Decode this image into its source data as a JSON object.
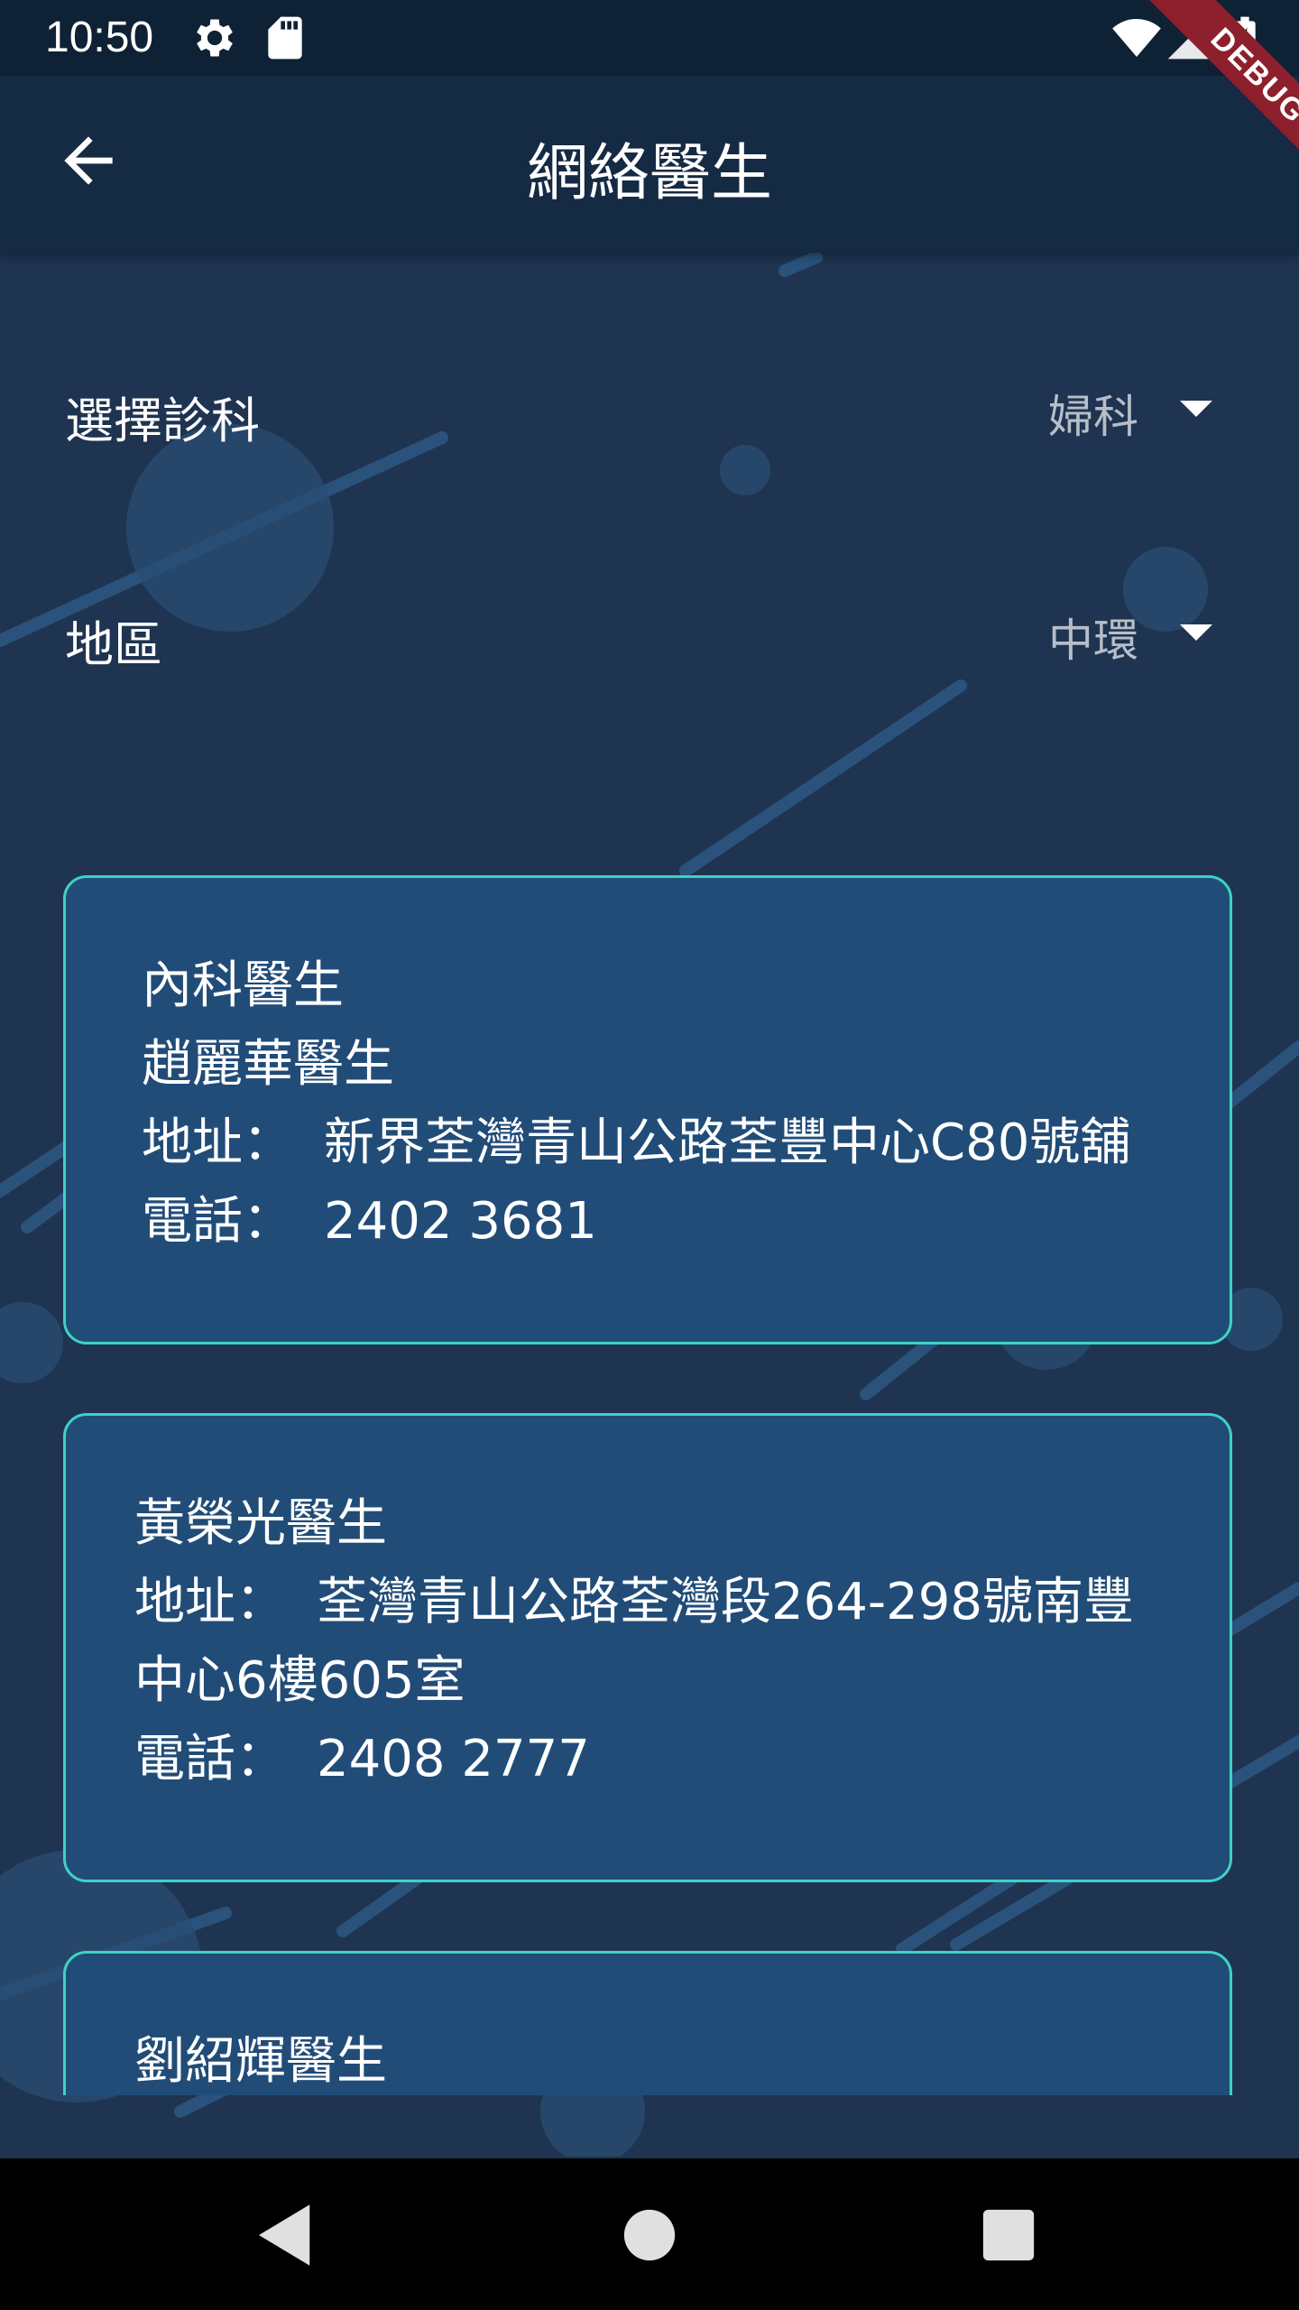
{
  "status_bar": {
    "time": "10:50",
    "icons": [
      "gear-icon",
      "sd-card-icon",
      "wifi-icon",
      "signal-icon",
      "battery-charging-icon"
    ]
  },
  "app_bar": {
    "title": "網絡醫生",
    "back_icon": "arrow-back-icon",
    "debug_label": "DEBUG"
  },
  "filters": {
    "specialty": {
      "label": "選擇診科",
      "value": "婦科"
    },
    "district": {
      "label": "地區",
      "value": "中環"
    }
  },
  "doctors": [
    {
      "specialty": "內科醫生",
      "name": "趙麗華醫生",
      "address_label": "地址：",
      "address": "新界荃灣青山公路荃豐中心C80號舖",
      "phone_label": "電話：",
      "phone": "2402 3681"
    },
    {
      "name": "黃榮光醫生",
      "address_label": "地址：",
      "address_line1": "荃灣青山公路荃灣段264-298號南豐",
      "address_line2": "中心6樓605室",
      "phone_label": "電話：",
      "phone": "2408 2777"
    },
    {
      "name": "劉紹輝醫生"
    }
  ],
  "colors": {
    "background": "#1f3451",
    "app_bar": "#152a43",
    "card": "#214c78",
    "card_border": "#3ed2c4",
    "debug_ribbon": "#8e1f2c"
  },
  "nav_bar": {
    "icons": [
      "back-triangle-icon",
      "home-circle-icon",
      "recents-square-icon"
    ]
  }
}
